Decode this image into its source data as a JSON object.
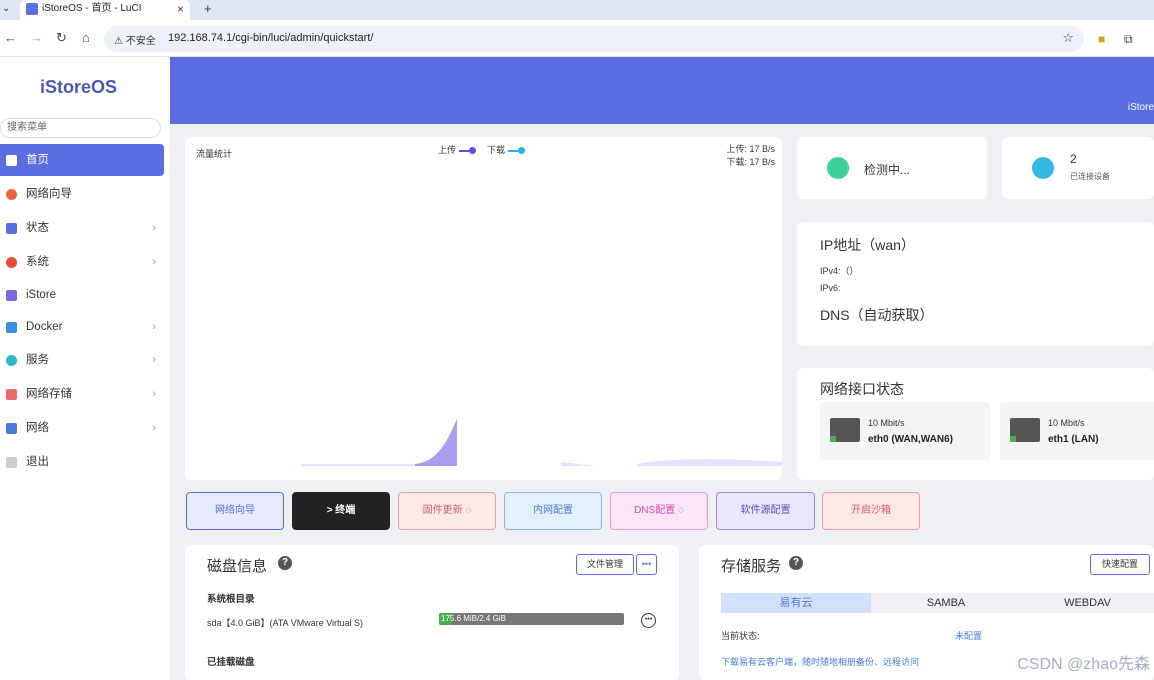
{
  "browser": {
    "tab_title": "iStoreOS - 首页 - LuCI",
    "security_label": "不安全",
    "url": "192.168.74.1/cgi-bin/luci/admin/quickstart/"
  },
  "sidebar": {
    "logo": "iStoreOS",
    "search_placeholder": "搜索菜单",
    "items": [
      {
        "label": "首页",
        "color": "#ffffff"
      },
      {
        "label": "网络向导",
        "color": "#e8663d"
      },
      {
        "label": "状态",
        "color": "#5b6ee1"
      },
      {
        "label": "系统",
        "color": "#e84a3d"
      },
      {
        "label": "iStore",
        "color": "#7a6ae1"
      },
      {
        "label": "Docker",
        "color": "#3a8ee6"
      },
      {
        "label": "服务",
        "color": "#2ab7c6"
      },
      {
        "label": "网络存储",
        "color": "#e86b6b"
      },
      {
        "label": "网络",
        "color": "#4a7ad9"
      },
      {
        "label": "退出",
        "color": "#888888"
      }
    ]
  },
  "header": {
    "right_text": "iStore"
  },
  "traffic": {
    "title": "流量统计",
    "legend_up": "上传",
    "legend_down": "下载",
    "up_rate": "上传: 17 B/s",
    "down_rate": "下载: 17 B/s",
    "up_color": "#5b4fe0",
    "down_color": "#2ab0e6"
  },
  "status_cards": {
    "checking": "检测中...",
    "devices_count": "2",
    "devices_label": "已连接设备"
  },
  "ip": {
    "title": "IP地址（wan）",
    "ipv4": "IPv4:（）",
    "ipv6": "IPv6:",
    "dns": "DNS（自动获取）"
  },
  "interfaces": {
    "title": "网络接口状态",
    "ports": [
      {
        "speed": "10 Mbit/s",
        "name": "eth0 (WAN,WAN6)"
      },
      {
        "speed": "10 Mbit/s",
        "name": "eth1 (LAN)"
      }
    ]
  },
  "actions": [
    {
      "label": "网络向导",
      "bg": "#e8ebfb",
      "border": "#5b6ee1",
      "color": "#5b6ee1"
    },
    {
      "label": "> 终端",
      "bg": "#222222",
      "border": "#222222",
      "color": "#ffffff"
    },
    {
      "label": "固件更新 ◌",
      "bg": "#fde8e8",
      "border": "#e8a0a0",
      "color": "#d06060"
    },
    {
      "label": "内网配置",
      "bg": "#e3effc",
      "border": "#8bb6e8",
      "color": "#4a7ad9"
    },
    {
      "label": "DNS配置 ◌",
      "bg": "#fbe6f6",
      "border": "#e89ad8",
      "color": "#d04ab8"
    },
    {
      "label": "软件源配置",
      "bg": "#ebe6fb",
      "border": "#9a8ae8",
      "color": "#5b4fb8"
    },
    {
      "label": "开启沙箱",
      "bg": "#fde8e8",
      "border": "#e8a0a0",
      "color": "#d06060"
    }
  ],
  "disk": {
    "title": "磁盘信息",
    "file_manager": "文件管理",
    "more": "•••",
    "root_title": "系统根目录",
    "root_device": "sda【4.0 GiB】(ATA VMware Virtual S)",
    "usage_text": "175.6 MiB/2.4 GiB",
    "usage_fraction": 0.07,
    "mounted_title": "已挂载磁盘"
  },
  "storage": {
    "title": "存储服务",
    "quick_config": "快速配置",
    "tabs": [
      "易有云",
      "SAMBA",
      "WEBDAV"
    ],
    "status_label": "当前状态:",
    "status_value": "未配置",
    "download_text": "下载易有云客户端，随时随地相册备份、远程访问"
  },
  "watermark": "CSDN @zhao先森"
}
